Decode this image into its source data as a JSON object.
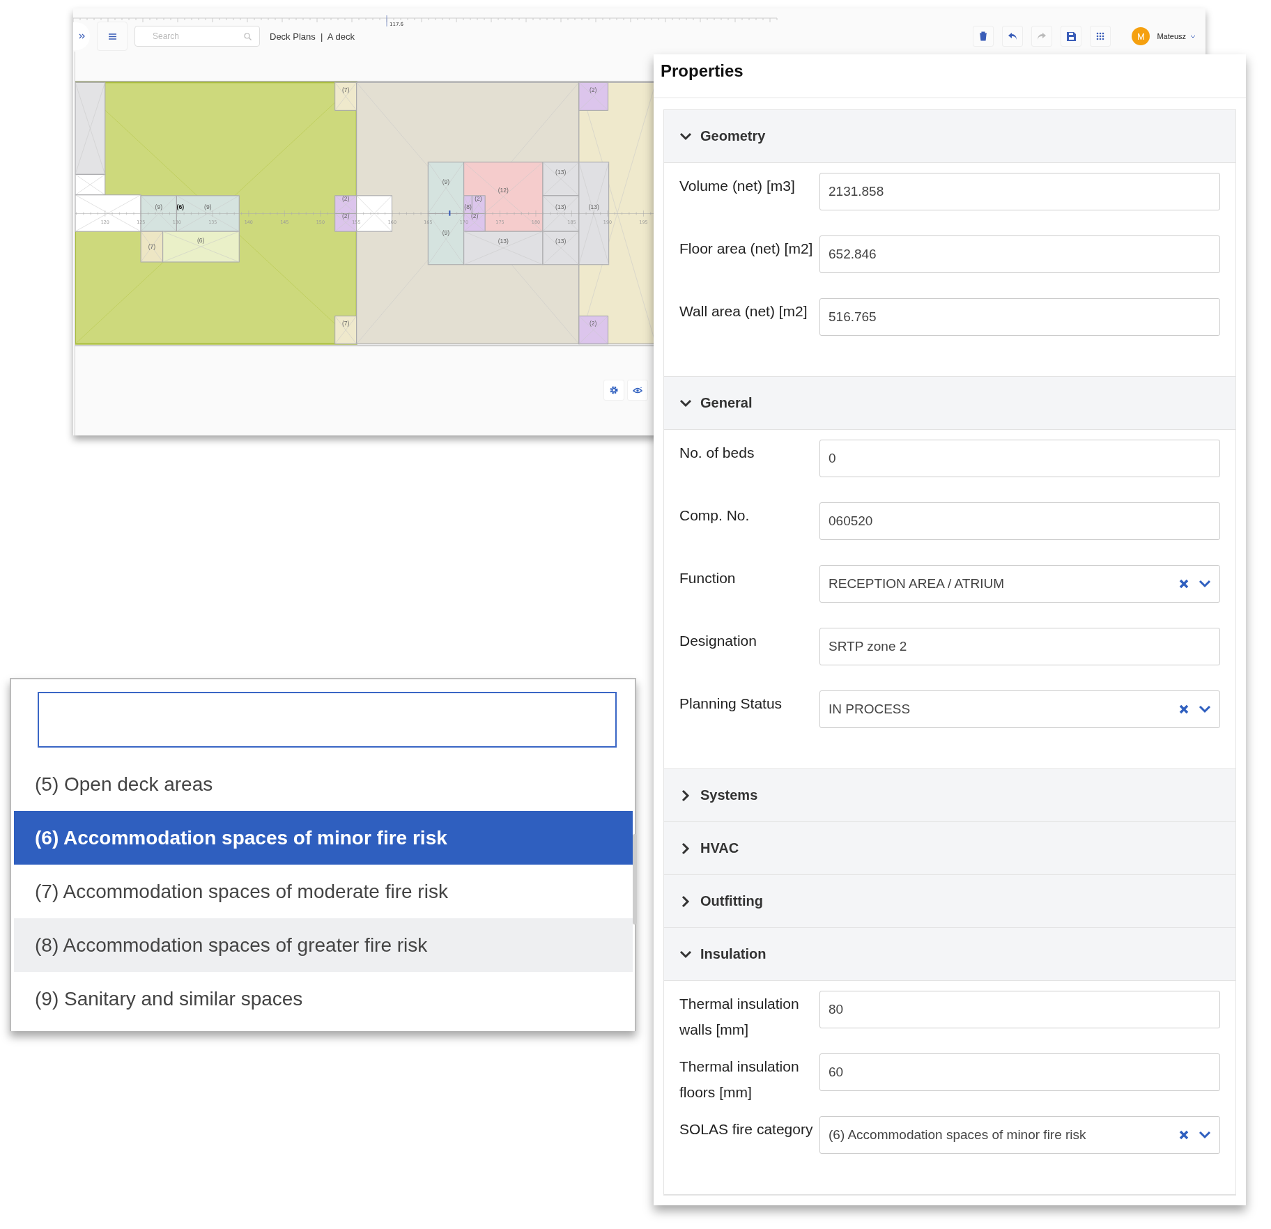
{
  "toolbar": {
    "search": {
      "placeholder": "Search"
    },
    "breadcrumb": "Deck Plans  |  A deck",
    "ruler_reading": "117.6",
    "buttons": [
      {
        "kind": "delete",
        "disabled": false
      },
      {
        "kind": "undo",
        "disabled": false
      },
      {
        "kind": "redo",
        "disabled": true
      },
      {
        "kind": "save",
        "disabled": false
      },
      {
        "kind": "apps",
        "disabled": false
      }
    ],
    "user": {
      "initial": "M",
      "name": "Mateusz"
    }
  },
  "plan": {
    "selection_label": "(6)",
    "rooms": [
      {
        "selected": true
      },
      {
        "selected": false
      },
      {
        "selected": false
      },
      {
        "selected": false
      },
      {
        "label": "(9)",
        "selected": false
      },
      {
        "label": "(9)",
        "selected": false
      },
      {
        "label": "(7)",
        "selected": false
      },
      {
        "label": "(6)",
        "selected": false
      },
      {
        "label": "(7)",
        "selected": false
      },
      {
        "label": "(2)",
        "selected": false
      },
      {
        "label": "(2)",
        "selected": false
      },
      {
        "label": "(7)",
        "selected": false
      },
      {
        "selected": false
      },
      {
        "selected": false
      },
      {
        "selected": false
      },
      {
        "label": "(2)",
        "selected": false
      },
      {
        "label": "(9)",
        "selected": false
      },
      {
        "label": "(9)",
        "selected": false
      },
      {
        "label": "(12)",
        "selected": false
      },
      {
        "label": "(8)",
        "selected": false
      },
      {
        "label": "(2)",
        "selected": false
      },
      {
        "label": "(2)",
        "selected": false
      },
      {
        "label": "(13)",
        "selected": false
      },
      {
        "label": "(13)",
        "selected": false
      },
      {
        "label": "(13)",
        "selected": false
      },
      {
        "label": "(13)",
        "selected": false
      },
      {
        "label": "(13)",
        "selected": false
      },
      {
        "label": "(2)",
        "selected": false
      }
    ],
    "axis_labels": [
      "120",
      "125",
      "130",
      "135",
      "140",
      "145",
      "150",
      "155",
      "160",
      "165",
      "170",
      "175",
      "180",
      "185",
      "190",
      "195"
    ]
  },
  "properties": {
    "title": "Properties",
    "sections": [
      {
        "title": "Geometry",
        "expanded": true,
        "fields": [
          {
            "kind": "text",
            "label": "Volume (net) [m3]",
            "value": "2131.858"
          },
          {
            "kind": "text",
            "label": "Floor area (net) [m2]",
            "value": "652.846"
          },
          {
            "kind": "text",
            "label": "Wall area (net) [m2]",
            "value": "516.765"
          }
        ]
      },
      {
        "title": "General",
        "expanded": true,
        "fields": [
          {
            "kind": "text",
            "label": "No. of beds",
            "value": "0"
          },
          {
            "kind": "text",
            "label": "Comp. No.",
            "value": "060520"
          },
          {
            "kind": "select",
            "label": "Function",
            "value": "RECEPTION AREA / ATRIUM"
          },
          {
            "kind": "text",
            "label": "Designation",
            "value": "SRTP zone 2"
          },
          {
            "kind": "select",
            "label": "Planning Status",
            "value": "IN PROCESS"
          }
        ]
      },
      {
        "title": "Systems",
        "expanded": false
      },
      {
        "title": "HVAC",
        "expanded": false
      },
      {
        "title": "Outfitting",
        "expanded": false
      },
      {
        "title": "Insulation",
        "expanded": true,
        "fields": [
          {
            "kind": "text",
            "label": "Thermal insulation walls [mm]",
            "value": "80"
          },
          {
            "kind": "text",
            "label": "Thermal insulation floors [mm]",
            "value": "60"
          },
          {
            "kind": "select",
            "label": "SOLAS fire category",
            "value": "(6) Accommodation spaces of minor fire risk"
          }
        ]
      }
    ]
  },
  "dropdown": {
    "options": [
      {
        "label": "(5) Open deck areas",
        "selected": false,
        "hovered": false
      },
      {
        "label": "(6) Accommodation spaces of minor fire risk",
        "selected": true,
        "hovered": false
      },
      {
        "label": "(7) Accommodation spaces of moderate fire risk",
        "selected": false,
        "hovered": false
      },
      {
        "label": "(8) Accommodation spaces of greater fire risk",
        "selected": false,
        "hovered": true
      },
      {
        "label": "(9) Sanitary and similar spaces",
        "selected": false,
        "hovered": false
      }
    ]
  }
}
